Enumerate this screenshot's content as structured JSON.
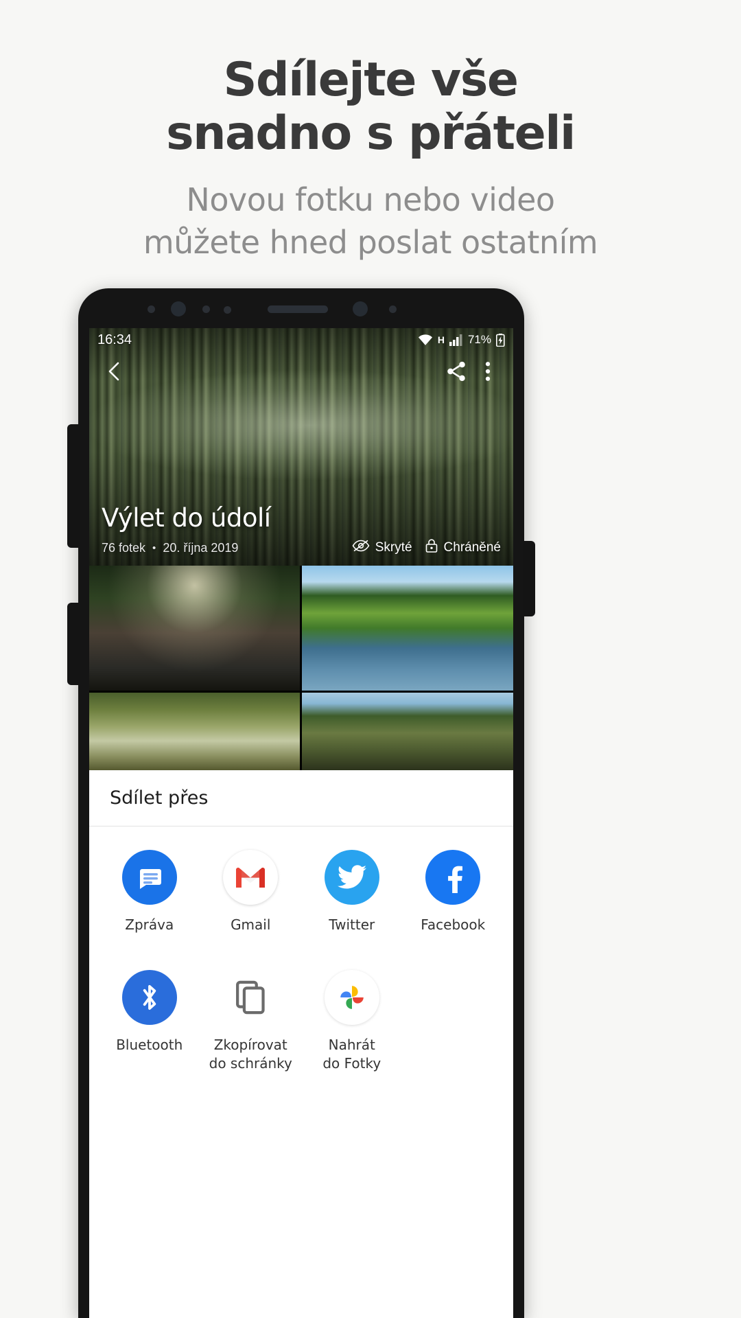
{
  "promo": {
    "title_line1": "Sdílejte vše",
    "title_line2": "snadno s přáteli",
    "subtitle_line1": "Novou fotku nebo video",
    "subtitle_line2": "můžete hned poslat ostatním"
  },
  "status_bar": {
    "time": "16:34",
    "network_label": "H",
    "battery": "71%",
    "wifi_icon": "wifi-icon",
    "signal_icon": "signal-bars-icon",
    "battery_icon": "battery-charging-icon"
  },
  "hero": {
    "back_icon": "back-chevron-icon",
    "share_icon": "share-icon",
    "more_icon": "more-vertical-icon",
    "title": "Výlet do údolí",
    "photo_count": "76 fotek",
    "separator": "•",
    "date": "20. října 2019",
    "hidden_label": "Skryté",
    "hidden_icon": "eye-slash-icon",
    "protected_label": "Chráněné",
    "protected_icon": "lock-icon"
  },
  "share_sheet": {
    "header": "Sdílet přes",
    "rows": [
      [
        {
          "label": "Zpráva",
          "icon": "messages-icon",
          "color": "#1a73e8"
        },
        {
          "label": "Gmail",
          "icon": "gmail-icon",
          "color": "#ea4335"
        },
        {
          "label": "Twitter",
          "icon": "twitter-icon",
          "color": "#29a3ef"
        },
        {
          "label": "Facebook",
          "icon": "facebook-icon",
          "color": "#1877f2"
        }
      ],
      [
        {
          "label": "Bluetooth",
          "icon": "bluetooth-icon",
          "color": "#2a6ddb"
        },
        {
          "label": "Zkopírovat\ndo schránky",
          "icon": "copy-to-clipboard-icon",
          "color": "#6b6b6b"
        },
        {
          "label": "Nahrát\ndo Fotky",
          "icon": "google-photos-icon",
          "color": "#4285f4"
        }
      ]
    ]
  },
  "colors": {
    "page_bg": "#f7f7f5",
    "title": "#3a3a3a",
    "subtitle": "#8d8d8d",
    "phone_frame": "#151515",
    "sheet_bg": "#ffffff"
  }
}
